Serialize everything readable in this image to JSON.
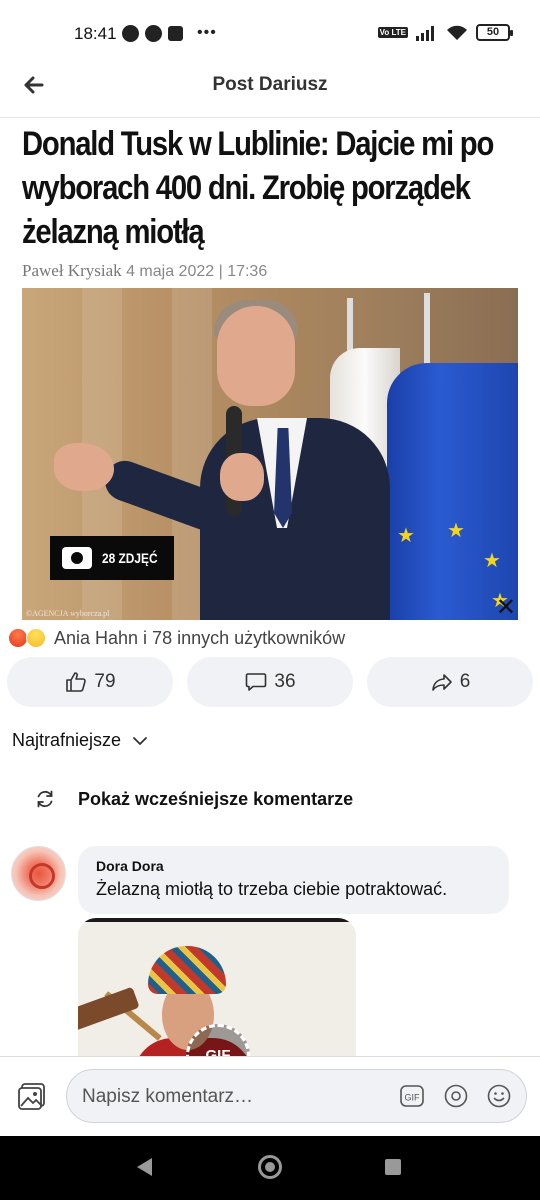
{
  "status_bar": {
    "time": "18:41",
    "dots": "•••",
    "network": "Vo LTE",
    "battery": "50"
  },
  "header": {
    "title": "Post Dariusz"
  },
  "article": {
    "headline": "Donald Tusk w Lublinie: Dajcie mi po wyborach 400 dni. Zrobię porządek żelazną miotłą",
    "author": "Paweł Krysiak",
    "date": "4 maja 2022 | 17:36",
    "photo_count": "28 ZDJĘĆ",
    "photo_credit": "©AGENCJA wyborcza.pl"
  },
  "reactions": {
    "summary": "Ania Hahn i 78 innych użytkowników",
    "emoji": [
      "angry",
      "haha"
    ]
  },
  "actions": {
    "like_count": "79",
    "comment_count": "36",
    "share_count": "6",
    "icons": [
      "thumbs-up-icon",
      "comment-icon",
      "share-icon"
    ]
  },
  "sort": {
    "label": "Najtrafniejsze"
  },
  "earlier_comments": {
    "label": "Pokaż wcześniejsze komentarze"
  },
  "comments": [
    {
      "author": "Dora Dora",
      "text": "Żelazną miotłą to trzeba ciebie potraktować.",
      "gif_badge": "GIF"
    }
  ],
  "composer": {
    "placeholder": "Napisz komentarz…",
    "gif_label": "GIF"
  },
  "colors": {
    "bubble": "#f0f2f5",
    "eu_blue": "#2b5bd1",
    "navbar": "#000000"
  }
}
